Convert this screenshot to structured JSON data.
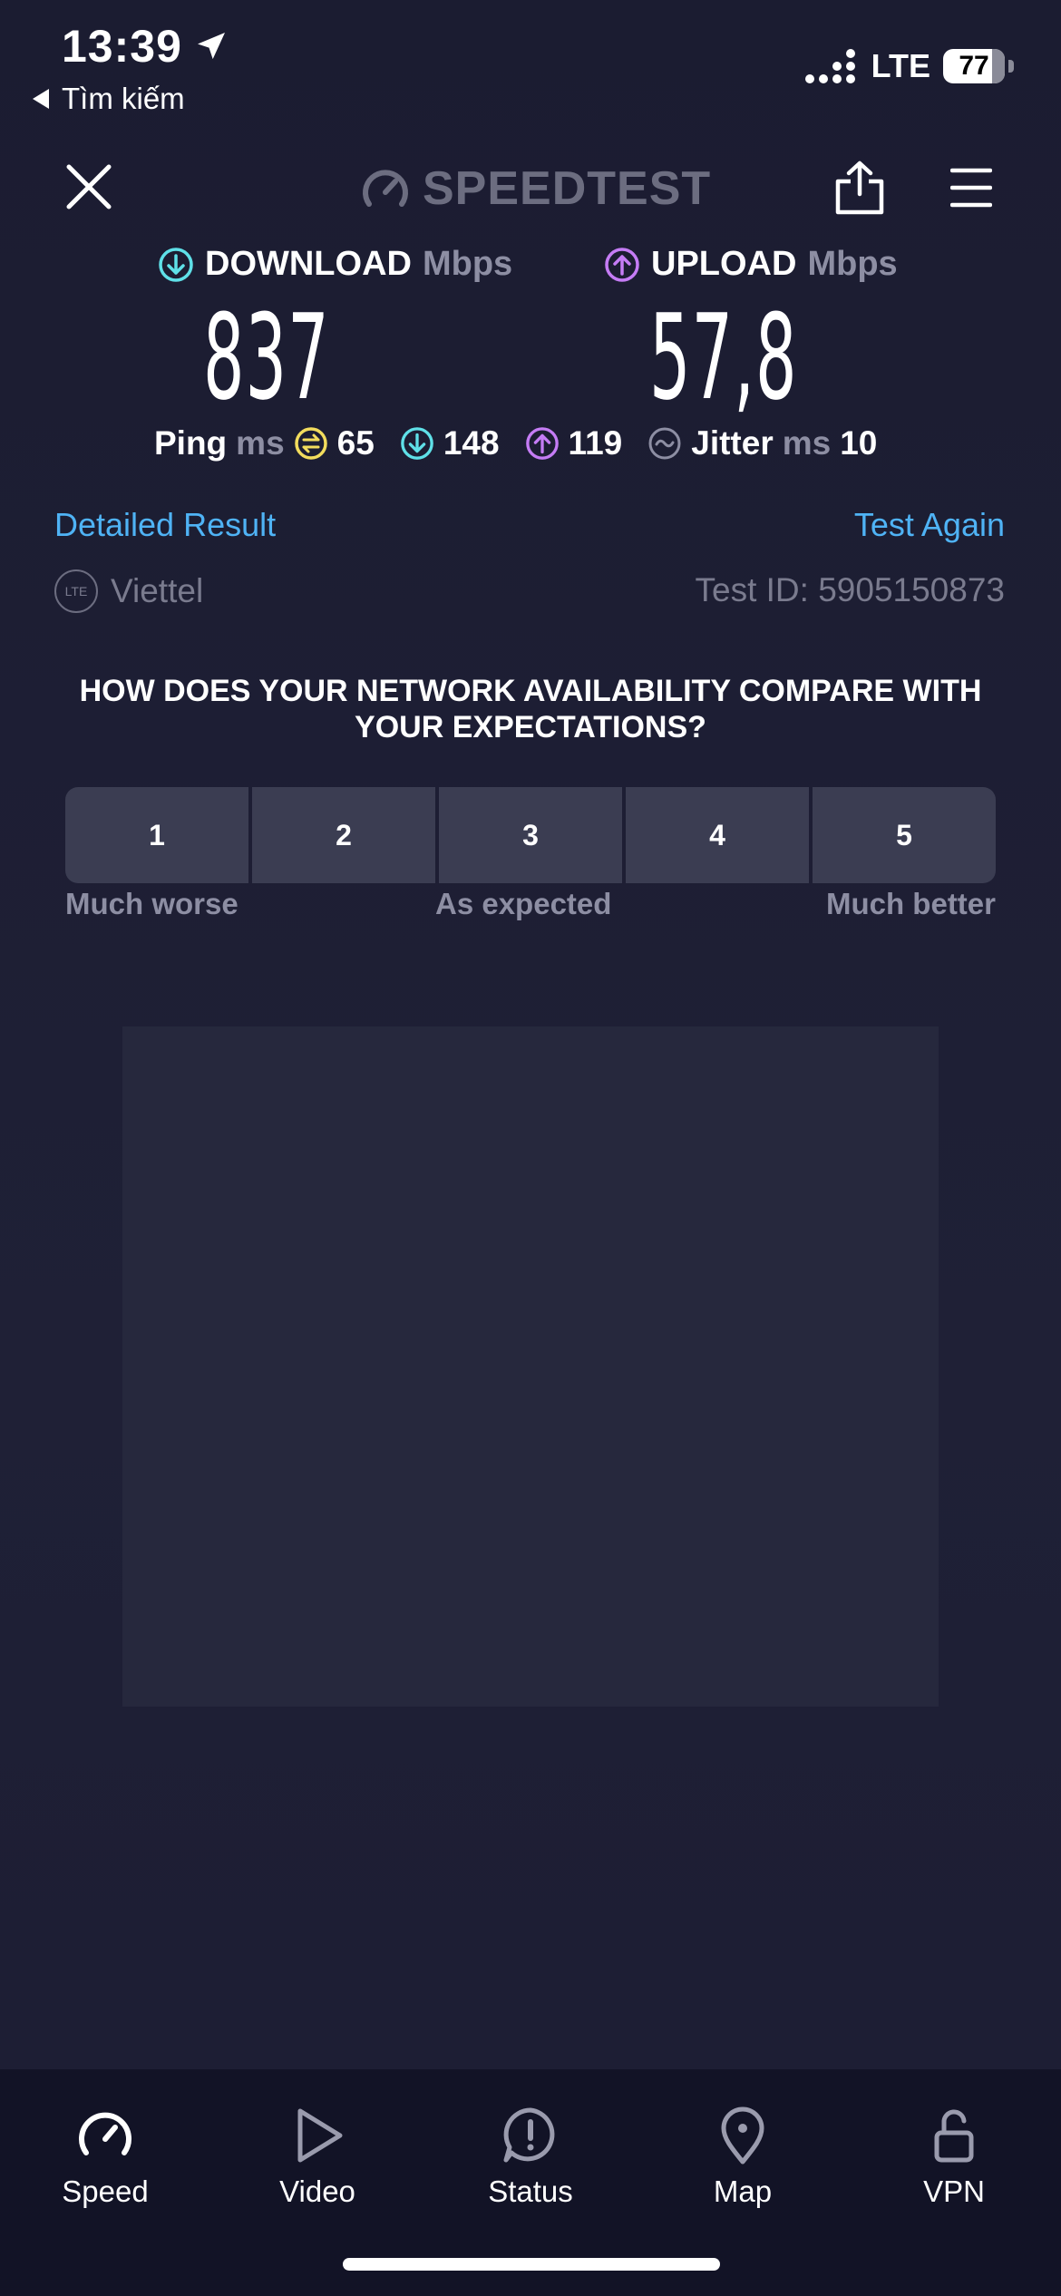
{
  "status_bar": {
    "time": "13:39",
    "back_label": "Tìm kiếm",
    "network": "LTE",
    "battery": "77"
  },
  "header": {
    "logo_text": "SPEEDTEST",
    "icons": [
      "close-icon",
      "speedometer-icon",
      "share-icon",
      "menu-icon"
    ]
  },
  "results": {
    "download": {
      "label": "DOWNLOAD",
      "unit": "Mbps",
      "value": "837"
    },
    "upload": {
      "label": "UPLOAD",
      "unit": "Mbps",
      "value": "57,8"
    },
    "ping": {
      "label": "Ping",
      "unit": "ms",
      "idle": "65",
      "download": "148",
      "upload": "119"
    },
    "jitter": {
      "label": "Jitter",
      "unit": "ms",
      "value": "10"
    }
  },
  "links": {
    "detailed": "Detailed Result",
    "again": "Test Again"
  },
  "provider": {
    "badge": "LTE",
    "name": "Viettel",
    "test_id": "Test ID: 5905150873"
  },
  "survey": {
    "question": "HOW DOES YOUR NETWORK AVAILABILITY COMPARE WITH YOUR EXPECTATIONS?",
    "options": [
      "1",
      "2",
      "3",
      "4",
      "5"
    ],
    "labels": {
      "low": "Much worse",
      "mid": "As expected",
      "high": "Much better"
    }
  },
  "nav": {
    "items": [
      {
        "label": "Speed",
        "icon": "speed-icon"
      },
      {
        "label": "Video",
        "icon": "play-icon"
      },
      {
        "label": "Status",
        "icon": "alert-bubble-icon"
      },
      {
        "label": "Map",
        "icon": "map-pin-icon"
      },
      {
        "label": "VPN",
        "icon": "lock-icon"
      }
    ]
  },
  "colors": {
    "background": "#1c1d33",
    "download_accent": "#5fe0e8",
    "upload_accent": "#c57cf5",
    "ping_accent": "#f2dc5d",
    "link": "#4fb3f5",
    "nav_bg": "#121326"
  }
}
